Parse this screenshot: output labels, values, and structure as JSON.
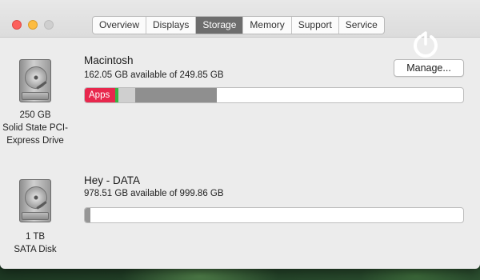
{
  "tabs": [
    {
      "label": "Overview",
      "active": false
    },
    {
      "label": "Displays",
      "active": false
    },
    {
      "label": "Storage",
      "active": true
    },
    {
      "label": "Memory",
      "active": false
    },
    {
      "label": "Support",
      "active": false
    },
    {
      "label": "Service",
      "active": false
    }
  ],
  "drives": [
    {
      "name": "Macintosh",
      "availability": "162.05 GB available of 249.85 GB",
      "caption": [
        "250 GB",
        "Solid State PCI-",
        "Express Drive"
      ],
      "segments": [
        {
          "label": "Apps",
          "color": "#e8274d"
        },
        {
          "label": "",
          "color": "#38b443"
        },
        {
          "label": "",
          "color": "#cfcfcf"
        },
        {
          "label": "",
          "color": "#8f8f8f"
        }
      ],
      "manage_label": "Manage..."
    },
    {
      "name": "Hey - DATA",
      "availability": "978.51 GB available of 999.86 GB",
      "caption": [
        "1 TB",
        "SATA Disk"
      ],
      "segments": [
        {
          "label": "",
          "color": "#969696"
        }
      ]
    }
  ],
  "colors": {
    "active_tab": "#6d6d6d",
    "apps": "#e8274d",
    "close": "#fc605c",
    "minimize": "#fdbc40",
    "zoom_disabled": "#cfcfcf"
  },
  "icons": [
    "close-button-icon",
    "minimize-button-icon",
    "zoom-button-icon",
    "hard-drive-icon",
    "watermark-logo-icon"
  ]
}
